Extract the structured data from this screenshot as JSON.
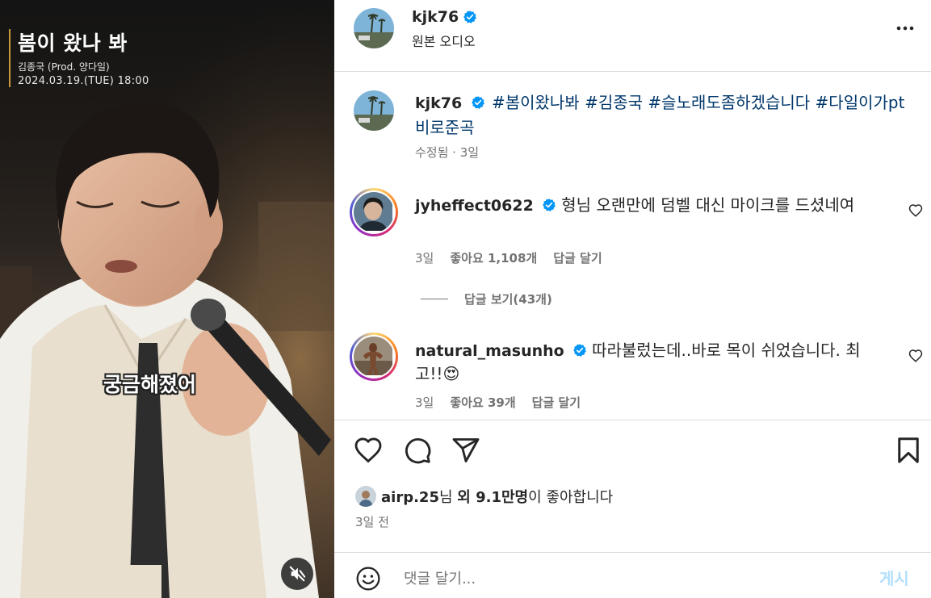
{
  "video": {
    "title": "봄이 왔나 봐",
    "credit": "김종국 (Prod. 양다일)",
    "date": "2024.03.19.(TUE) 18:00",
    "subtitle": "궁금해졌어",
    "mute_icon": "speaker-muted-icon"
  },
  "header": {
    "username": "kjk76",
    "audio": "원본 오디오",
    "more_icon": "more-horizontal-icon"
  },
  "caption": {
    "username": "kjk76",
    "hashtags": [
      "#봄이왔나봐",
      "#김종국",
      "#슬노래도좀하겠습니다",
      "#다일이가pt비로준곡"
    ],
    "meta": "수정됨 · 3일"
  },
  "comments": [
    {
      "username": "jyheffect0622",
      "text": "형님 오랜만에 덤벨 대신 마이크를 드셨네여",
      "time": "3일",
      "likes": "좋아요 1,108개",
      "reply": "답글 달기",
      "view_replies": "답글 보기(43개)"
    },
    {
      "username": "natural_masunho",
      "text": "따라불렀는데..바로 목이 쉬었습니다. 최고!!",
      "emoji": "😍",
      "time": "3일",
      "likes": "좋아요 39개",
      "reply": "답글 달기"
    }
  ],
  "actions": {
    "icons": [
      "heart-icon",
      "comment-icon",
      "share-icon",
      "bookmark-icon"
    ]
  },
  "likes": {
    "user": "airp.25",
    "suffix1": "님 ",
    "others": "외 9.1만명",
    "suffix2": "이 좋아합니다"
  },
  "time_ago": "3일 전",
  "comment_box": {
    "placeholder": "댓글 달기...",
    "post_label": "게시"
  }
}
